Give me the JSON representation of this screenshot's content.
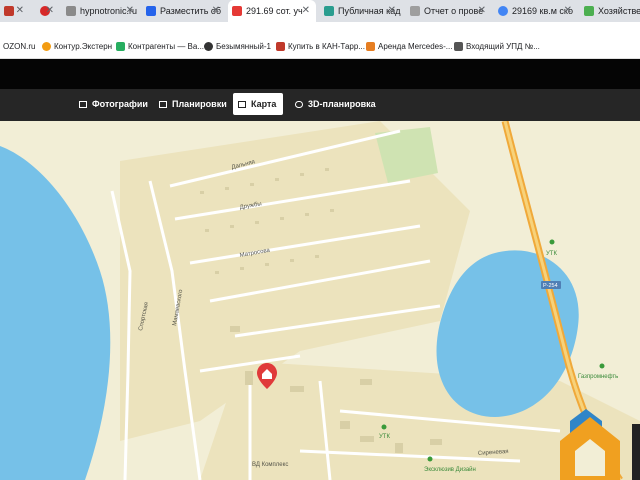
{
  "browser": {
    "tabs": [
      {
        "label": ""
      },
      {
        "label": ""
      },
      {
        "label": "hypnotronic.ru"
      },
      {
        "label": "Разместить об"
      },
      {
        "label": "291.69 сот. уч"
      },
      {
        "label": "Публичная кад"
      },
      {
        "label": "Отчет о прове"
      },
      {
        "label": "29169 кв.м ско"
      },
      {
        "label": "Хозяйственн"
      }
    ],
    "bookmarks": [
      {
        "label": "OZON.ru"
      },
      {
        "label": "Контур.Экстерн"
      },
      {
        "label": "Контрагенты — Ва..."
      },
      {
        "label": "Безымянный-1"
      },
      {
        "label": "Купить в КАН-Тарр..."
      },
      {
        "label": "Аренда Mercedes-..."
      },
      {
        "label": "Входящий УПД №..."
      }
    ]
  },
  "nav": {
    "photos": "Фотографии",
    "plans": "Планировки",
    "map": "Карта",
    "plans3d": "3D-планировка"
  },
  "map": {
    "streets": {
      "dalnyaya": "Дальняя",
      "druzhby": "Дружбы",
      "matrosova": "Матросова",
      "sportivnaya": "Спортская",
      "mamayskogo": "Мамаевского",
      "sirenevaya": "Сиреневая"
    },
    "highway": "Р-254",
    "pois": {
      "utk1": "УТК",
      "utk2": "УТК",
      "gazpromneft": "Газпромнефть",
      "eksklyuziv": "Эксклюзив Дизайн",
      "kompleks": "ВД Комплекс"
    }
  }
}
